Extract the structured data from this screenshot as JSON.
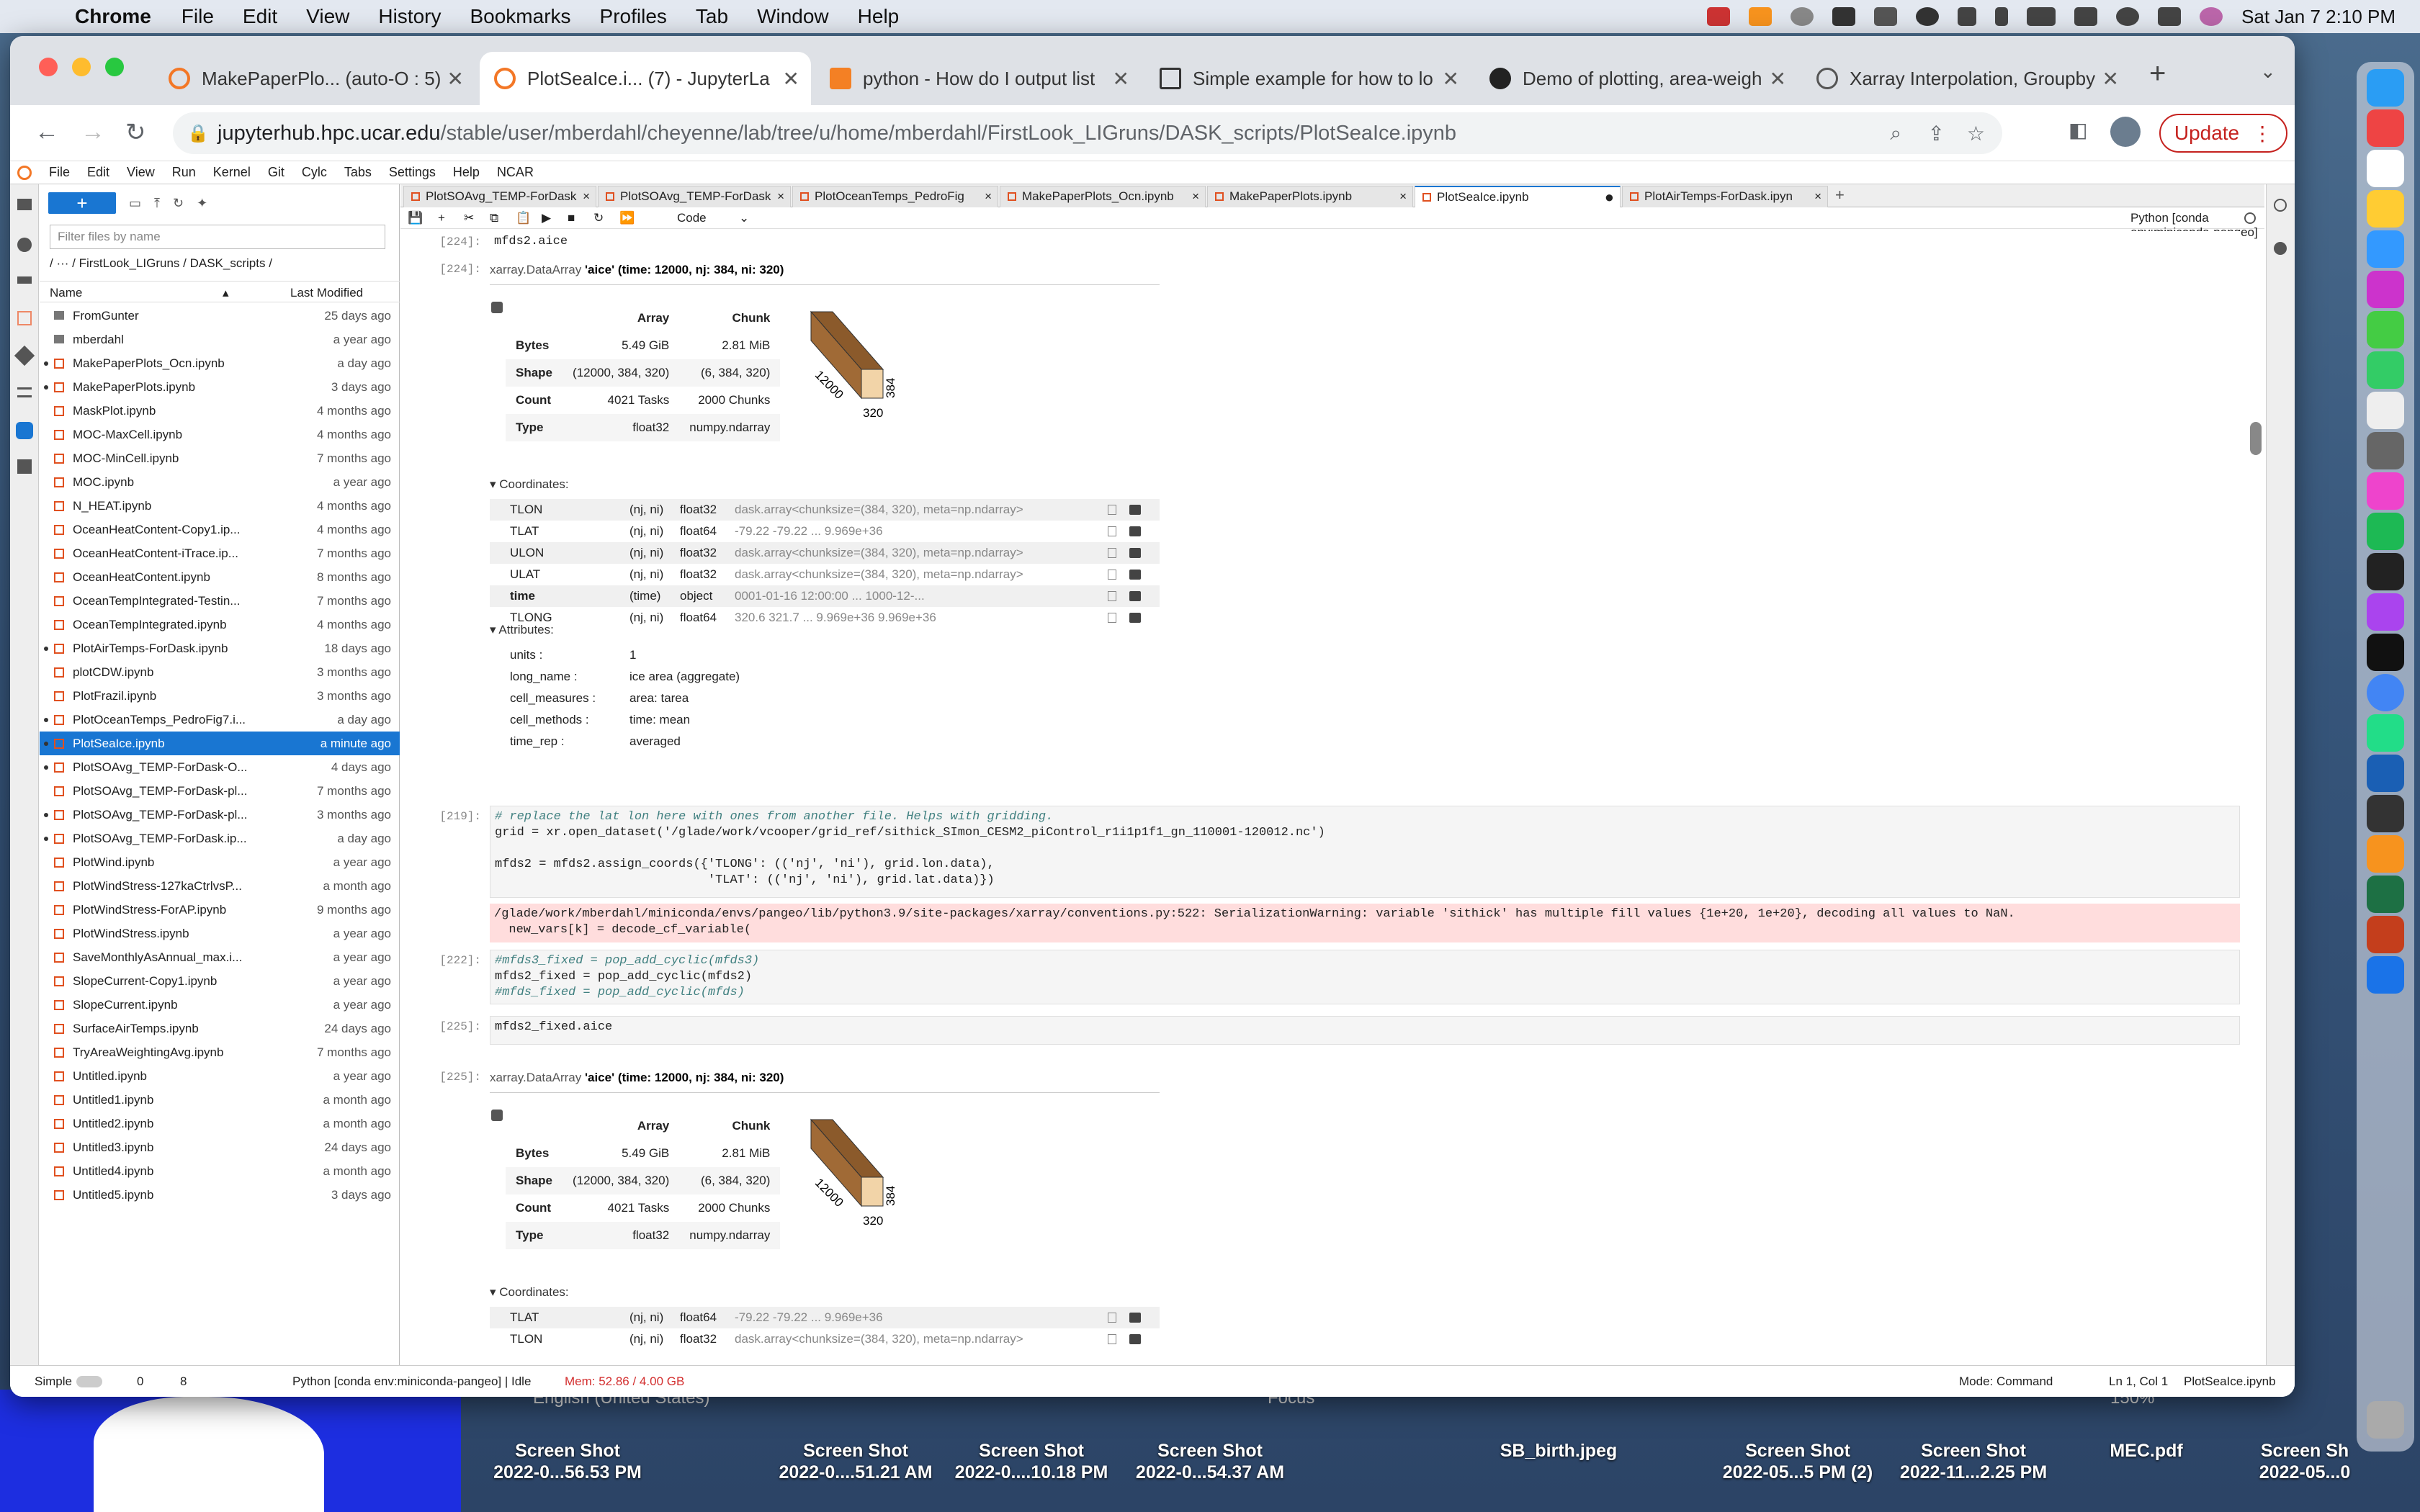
{
  "menubar": {
    "app": "Chrome",
    "items": [
      "File",
      "Edit",
      "View",
      "History",
      "Bookmarks",
      "Profiles",
      "Tab",
      "Window",
      "Help"
    ],
    "clock": "Sat Jan 7  2:10 PM"
  },
  "browser": {
    "tabs": [
      "MakePaperPlo... (auto-O : 5)",
      "PlotSeaIce.i... (7) - JupyterLa",
      "python - How do I output list",
      "Simple example for how to lo",
      "Demo of plotting, area-weigh",
      "Xarray Interpolation, Groupby"
    ],
    "url_host": "jupyterhub.hpc.ucar.edu",
    "url_path": "/stable/user/mberdahl/cheyenne/lab/tree/u/home/mberdahl/FirstLook_LIGruns/DASK_scripts/PlotSeaIce.ipynb",
    "update_label": "Update"
  },
  "jupyter": {
    "menu": [
      "File",
      "Edit",
      "View",
      "Run",
      "Kernel",
      "Git",
      "Cylc",
      "Tabs",
      "Settings",
      "Help",
      "NCAR"
    ],
    "filter_placeholder": "Filter files by name",
    "breadcrumb": "/   ···   / FirstLook_LIGruns / DASK_scripts /",
    "col_name": "Name",
    "col_modified": "Last Modified",
    "files": [
      {
        "name": "FromGunter",
        "mod": "25 days ago",
        "folder": true
      },
      {
        "name": "mberdahl",
        "mod": "a year ago",
        "folder": true
      },
      {
        "name": "MakePaperPlots_Ocn.ipynb",
        "mod": "a day ago",
        "dot": true
      },
      {
        "name": "MakePaperPlots.ipynb",
        "mod": "3 days ago",
        "dot": true
      },
      {
        "name": "MaskPlot.ipynb",
        "mod": "4 months ago"
      },
      {
        "name": "MOC-MaxCell.ipynb",
        "mod": "4 months ago"
      },
      {
        "name": "MOC-MinCell.ipynb",
        "mod": "7 months ago"
      },
      {
        "name": "MOC.ipynb",
        "mod": "a year ago"
      },
      {
        "name": "N_HEAT.ipynb",
        "mod": "4 months ago"
      },
      {
        "name": "OceanHeatContent-Copy1.ip...",
        "mod": "4 months ago"
      },
      {
        "name": "OceanHeatContent-iTrace.ip...",
        "mod": "7 months ago"
      },
      {
        "name": "OceanHeatContent.ipynb",
        "mod": "8 months ago"
      },
      {
        "name": "OceanTempIntegrated-Testin...",
        "mod": "7 months ago"
      },
      {
        "name": "OceanTempIntegrated.ipynb",
        "mod": "4 months ago"
      },
      {
        "name": "PlotAirTemps-ForDask.ipynb",
        "mod": "18 days ago",
        "dot": true
      },
      {
        "name": "plotCDW.ipynb",
        "mod": "3 months ago"
      },
      {
        "name": "PlotFrazil.ipynb",
        "mod": "3 months ago"
      },
      {
        "name": "PlotOceanTemps_PedroFig7.i...",
        "mod": "a day ago",
        "dot": true
      },
      {
        "name": "PlotSeaIce.ipynb",
        "mod": "a minute ago",
        "dot": true,
        "selected": true
      },
      {
        "name": "PlotSOAvg_TEMP-ForDask-O...",
        "mod": "4 days ago",
        "dot": true
      },
      {
        "name": "PlotSOAvg_TEMP-ForDask-pl...",
        "mod": "7 months ago"
      },
      {
        "name": "PlotSOAvg_TEMP-ForDask-pl...",
        "mod": "3 months ago",
        "dot": true
      },
      {
        "name": "PlotSOAvg_TEMP-ForDask.ip...",
        "mod": "a day ago",
        "dot": true
      },
      {
        "name": "PlotWind.ipynb",
        "mod": "a year ago"
      },
      {
        "name": "PlotWindStress-127kaCtrlvsP...",
        "mod": "a month ago"
      },
      {
        "name": "PlotWindStress-ForAP.ipynb",
        "mod": "9 months ago"
      },
      {
        "name": "PlotWindStress.ipynb",
        "mod": "a year ago"
      },
      {
        "name": "SaveMonthlyAsAnnual_max.i...",
        "mod": "a year ago"
      },
      {
        "name": "SlopeCurrent-Copy1.ipynb",
        "mod": "a year ago"
      },
      {
        "name": "SlopeCurrent.ipynb",
        "mod": "a year ago"
      },
      {
        "name": "SurfaceAirTemps.ipynb",
        "mod": "24 days ago"
      },
      {
        "name": "TryAreaWeightingAvg.ipynb",
        "mod": "7 months ago"
      },
      {
        "name": "Untitled.ipynb",
        "mod": "a year ago"
      },
      {
        "name": "Untitled1.ipynb",
        "mod": "a month ago"
      },
      {
        "name": "Untitled2.ipynb",
        "mod": "a month ago"
      },
      {
        "name": "Untitled3.ipynb",
        "mod": "24 days ago"
      },
      {
        "name": "Untitled4.ipynb",
        "mod": "a month ago"
      },
      {
        "name": "Untitled5.ipynb",
        "mod": "3 days ago"
      }
    ],
    "doc_tabs": [
      "PlotSOAvg_TEMP-ForDask",
      "PlotSOAvg_TEMP-ForDask",
      "PlotOceanTemps_PedroFig",
      "MakePaperPlots_Ocn.ipynb",
      "MakePaperPlots.ipynb",
      "PlotSeaIce.ipynb",
      "PlotAirTemps-ForDask.ipyn"
    ],
    "cell_type": "Code",
    "kernel": "Python [conda env:miniconda-pangeo]",
    "cells": {
      "c1_prompt": "[224]:",
      "c1_code": "mfds2.aice",
      "o1_prompt": "[224]:",
      "dataarray_hdr": "xarray.DataArray",
      "var": "'aice'",
      "dims": "(time: 12000, nj: 384, ni: 320)",
      "table": {
        "h_array": "Array",
        "h_chunk": "Chunk",
        "rows": [
          [
            "Bytes",
            "5.49 GiB",
            "2.81 MiB"
          ],
          [
            "Shape",
            "(12000, 384, 320)",
            "(6, 384, 320)"
          ],
          [
            "Count",
            "4021 Tasks",
            "2000 Chunks"
          ],
          [
            "Type",
            "float32",
            "numpy.ndarray"
          ]
        ]
      },
      "cube": {
        "d1": "12000",
        "d2": "384",
        "d3": "320"
      },
      "coords_title": "▾ Coordinates:",
      "coords": [
        [
          "TLON",
          "(nj, ni)",
          "float32",
          "dask.array<chunksize=(384, 320), meta=np.ndarray>"
        ],
        [
          "TLAT",
          "(nj, ni)",
          "float64",
          "-79.22 -79.22 ... 9.969e+36"
        ],
        [
          "ULON",
          "(nj, ni)",
          "float32",
          "dask.array<chunksize=(384, 320), meta=np.ndarray>"
        ],
        [
          "ULAT",
          "(nj, ni)",
          "float32",
          "dask.array<chunksize=(384, 320), meta=np.ndarray>"
        ],
        [
          "time",
          "(time)",
          "object",
          "0001-01-16 12:00:00 ... 1000-12-..."
        ],
        [
          "TLONG",
          "(nj, ni)",
          "float64",
          "320.6 321.7 ... 9.969e+36 9.969e+36"
        ]
      ],
      "attrs_title": "▾ Attributes:",
      "attrs": [
        [
          "units :",
          "1"
        ],
        [
          "long_name :",
          "ice area  (aggregate)"
        ],
        [
          "cell_measures :",
          "area: tarea"
        ],
        [
          "cell_methods :",
          "time: mean"
        ],
        [
          "time_rep :",
          "averaged"
        ]
      ],
      "c2_prompt": "[219]:",
      "c2_l1": "# replace the lat lon here with ones from another file. Helps with gridding.",
      "c2_l2": "grid = xr.open_dataset('/glade/work/vcooper/grid_ref/sithick_SImon_CESM2_piControl_r1i1p1f1_gn_110001-120012.nc')",
      "c2_l3": "mfds2 = mfds2.assign_coords({'TLONG': (('nj', 'ni'), grid.lon.data),",
      "c2_l4": "                             'TLAT': (('nj', 'ni'), grid.lat.data)})",
      "warn1": "/glade/work/mberdahl/miniconda/envs/pangeo/lib/python3.9/site-packages/xarray/conventions.py:522: SerializationWarning: variable 'sithick' has multiple fill values {1e+20, 1e+20}, decoding all values to NaN.",
      "warn2": "  new_vars[k] = decode_cf_variable(",
      "c3_prompt": "[222]:",
      "c3_l1": "#mfds3_fixed = pop_add_cyclic(mfds3)",
      "c3_l2": "mfds2_fixed = pop_add_cyclic(mfds2)",
      "c3_l3": "#mfds_fixed = pop_add_cyclic(mfds)",
      "c4_prompt": "[225]:",
      "c4_code": "mfds2_fixed.aice",
      "o4_prompt": "[225]:",
      "coords2": [
        [
          "TLAT",
          "(nj, ni)",
          "float64",
          "-79.22 -79.22 ... 9.969e+36"
        ],
        [
          "TLON",
          "(nj, ni)",
          "float32",
          "dask.array<chunksize=(384, 320), meta=np.ndarray>"
        ]
      ]
    },
    "status": {
      "mode_label": "Simple",
      "n0": "0",
      "n8": "8",
      "kernel": "Python [conda env:miniconda-pangeo] | Idle",
      "mem": "Mem: 52.86 / 4.00 GB",
      "mode": "Mode: Command",
      "pos": "Ln 1, Col 1",
      "file": "PlotSeaIce.ipynb"
    }
  },
  "desktop": {
    "below_window": "English (United States)",
    "focus": "Focus",
    "zoom": "150%",
    "icons": [
      {
        "l1": "Screen Shot",
        "l2": "2022-0...56.53 PM"
      },
      {
        "l1": "Screen Shot",
        "l2": "2022-0....51.21 AM"
      },
      {
        "l1": "Screen Shot",
        "l2": "2022-0....10.18 PM"
      },
      {
        "l1": "Screen Shot",
        "l2": "2022-0...54.37 AM"
      },
      {
        "l1": "SB_birth.jpeg",
        "l2": ""
      },
      {
        "l1": "Screen Shot",
        "l2": "2022-05...5 PM (2)"
      },
      {
        "l1": "Screen Shot",
        "l2": "2022-11...2.25 PM"
      },
      {
        "l1": "MEC.pdf",
        "l2": ""
      },
      {
        "l1": "Screen Sh",
        "l2": "2022-05...0"
      }
    ]
  }
}
